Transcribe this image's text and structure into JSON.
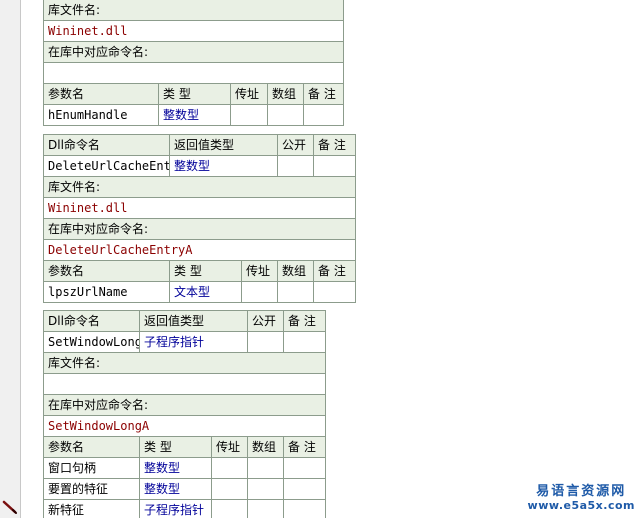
{
  "table1": {
    "lib_label": "库文件名:",
    "lib_value": "Wininet.dll",
    "cmd_label": "在库中对应命令名:",
    "cmd_value": "",
    "param_headers": [
      "参数名",
      "类 型",
      "传址",
      "数组",
      "备 注"
    ],
    "params": [
      {
        "name": "hEnumHandle",
        "type": "整数型"
      }
    ]
  },
  "table2": {
    "headers": [
      "Dll命令名",
      "返回值类型",
      "公开",
      "备 注"
    ],
    "name": "DeleteUrlCacheEntry",
    "return_type": "整数型",
    "lib_label": "库文件名:",
    "lib_value": "Wininet.dll",
    "cmd_label": "在库中对应命令名:",
    "cmd_value": "DeleteUrlCacheEntryA",
    "param_headers": [
      "参数名",
      "类 型",
      "传址",
      "数组",
      "备 注"
    ],
    "params": [
      {
        "name": "lpszUrlName",
        "type": "文本型"
      }
    ]
  },
  "table3": {
    "headers": [
      "Dll命令名",
      "返回值类型",
      "公开",
      "备 注"
    ],
    "name": "SetWindowLongA",
    "return_type": "子程序指针",
    "lib_label": "库文件名:",
    "lib_value": "",
    "cmd_label": "在库中对应命令名:",
    "cmd_value": "SetWindowLongA",
    "param_headers": [
      "参数名",
      "类 型",
      "传址",
      "数组",
      "备 注"
    ],
    "params": [
      {
        "name": "窗口句柄",
        "type": "整数型"
      },
      {
        "name": "要置的特征",
        "type": "整数型"
      },
      {
        "name": "新特征",
        "type": "子程序指针"
      }
    ]
  },
  "watermark": {
    "title": "易语言资源网",
    "url": "www.e5a5x.com"
  },
  "colors": {
    "header_bg": "#e9f0e4",
    "border": "#8c9c8c",
    "library_text": "#8b0000",
    "type_link": "#000099",
    "watermark": "#1e5aa8"
  },
  "icons": [
    "pen-icon"
  ]
}
